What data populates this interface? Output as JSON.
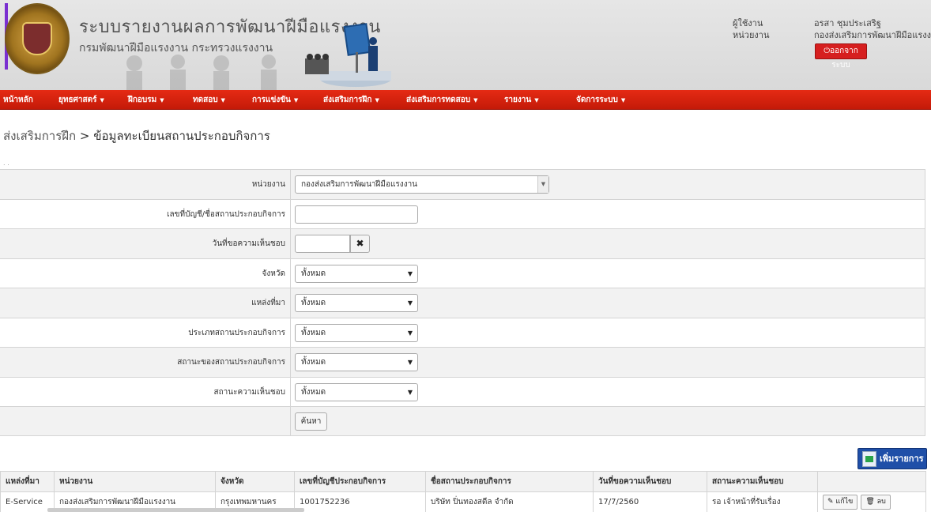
{
  "header": {
    "title": "ระบบรายงานผลการพัฒนาฝีมือแรงงาน",
    "subtitle": "กรมพัฒนาฝีมือแรงงาน กระทรวงแรงงาน",
    "user_label": "ผู้ใช้งาน",
    "unit_label": "หน่วยงาน",
    "user_name": "อรสา ชุมประเสริฐ",
    "user_unit": "กองส่งเสริมการพัฒนาฝีมือแรงงาน",
    "logout_label": "ออกจากระบบ"
  },
  "nav": {
    "items": [
      {
        "label": "หน้าหลัก",
        "caret": ""
      },
      {
        "label": "ยุทธศาสตร์",
        "caret": "▼"
      },
      {
        "label": "ฝึกอบรม",
        "caret": "▼"
      },
      {
        "label": "ทดสอบ",
        "caret": "▼"
      },
      {
        "label": "การแข่งขัน",
        "caret": "▼"
      },
      {
        "label": "ส่งเสริมการฝึก",
        "caret": "▼"
      },
      {
        "label": "ส่งเสริมการทดสอบ",
        "caret": "▼"
      },
      {
        "label": "รายงาน",
        "caret": "▼"
      },
      {
        "label": "จัดการระบบ",
        "caret": "▼"
      }
    ]
  },
  "breadcrumb": {
    "parent": "ส่งเสริมการฝึก",
    "separator": ">",
    "current": "ข้อมูลทะเบียนสถานประกอบกิจการ"
  },
  "form": {
    "unit_label": "หน่วยงาน",
    "unit_value": "กองส่งเสริมการพัฒนาฝีมือแรงงาน",
    "account_label": "เลขที่บัญชี/ชื่อสถานประกอบกิจการ",
    "account_value": "",
    "request_date_label": "วันที่ขอความเห็นชอบ",
    "request_date_value": "",
    "clear_symbol": "✖",
    "province_label": "จังหวัด",
    "province_value": "ทั้งหมด",
    "source_label": "แหล่งที่มา",
    "source_value": "ทั้งหมด",
    "type_label": "ประเภทสถานประกอบกิจการ",
    "type_value": "ทั้งหมด",
    "status_label": "สถานะของสถานประกอบกิจการ",
    "status_value": "ทั้งหมด",
    "approval_label": "สถานะความเห็นชอบ",
    "approval_value": "ทั้งหมด",
    "search_label": "ค้นหา"
  },
  "add_button": {
    "label": "เพิ่มรายการ"
  },
  "table": {
    "columns": [
      "แหล่งที่มา",
      "หน่วยงาน",
      "จังหวัด",
      "เลขที่บัญชีประกอบกิจการ",
      "ชื่อสถานประกอบกิจการ",
      "วันที่ขอความเห็นชอบ",
      "สถานะความเห็นชอบ",
      ""
    ],
    "rows": [
      {
        "source": "E-Service",
        "unit": "กองส่งเสริมการพัฒนาฝีมือแรงงาน",
        "province": "กรุงเทพมหานคร",
        "account_no": "1001752236",
        "company": "บริษัท ปิ่นทองสตีล จำกัด",
        "request_date": "17/7/2560",
        "status": "รอ เจ้าหน้าที่รับเรื่อง",
        "edit_label": "แก้ไข",
        "delete_label": "ลบ"
      }
    ]
  },
  "colors": {
    "nav_red": "#d4220e",
    "logout_red": "#d61f1f",
    "add_blue": "#1f4fa8"
  }
}
